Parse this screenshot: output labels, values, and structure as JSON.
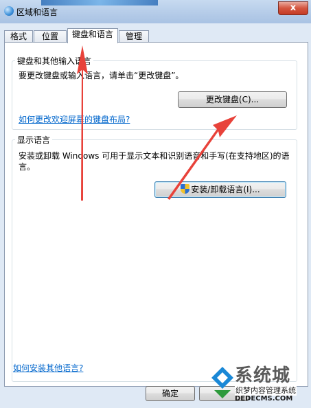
{
  "window": {
    "title": "区域和语言",
    "close_label": "x"
  },
  "tabs": [
    {
      "label": "格式"
    },
    {
      "label": "位置"
    },
    {
      "label": "键盘和语言"
    },
    {
      "label": "管理"
    }
  ],
  "keyboard_group": {
    "title": "键盘和其他输入语言",
    "description": "要更改键盘或输入语言，请单击“更改键盘”。",
    "change_button": "更改键盘(C)...",
    "welcome_link": "如何更改欢迎屏幕的键盘布局?"
  },
  "display_group": {
    "title": "显示语言",
    "description_line1": "安装或卸载 Windows 可用于显示文本和识别语音和手写(在支持地区)的语",
    "description_line2": "言。",
    "install_button": "安装/卸载语言(I)..."
  },
  "install_other_link": "如何安装其他语言?",
  "footer": {
    "ok_button": "确定"
  },
  "watermark": {
    "brand": "系统城",
    "site_name": "织梦内容管理系统",
    "site_url": "DEDECMS.COM"
  },
  "colors": {
    "arrow": "#e8423a",
    "link": "#0066cc"
  }
}
